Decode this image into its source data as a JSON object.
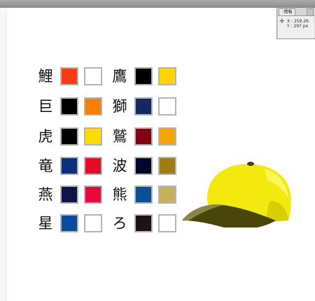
{
  "info_panel": {
    "tab_label": "情報",
    "x_label": "X",
    "x_value": ": 259.26",
    "y_label": "Y",
    "y_value": ": 297 px",
    "crosshair_icon": "crosshair-icon"
  },
  "teams": [
    {
      "name": "鯉",
      "colors": [
        "#fa3c14",
        "#ffffff"
      ]
    },
    {
      "name": "巨",
      "colors": [
        "#000000",
        "#f67f00"
      ]
    },
    {
      "name": "虎",
      "colors": [
        "#000000",
        "#ffdc00"
      ]
    },
    {
      "name": "竜",
      "colors": [
        "#0a2f7b",
        "#e60a28"
      ]
    },
    {
      "name": "燕",
      "colors": [
        "#0f1446",
        "#e6093c"
      ]
    },
    {
      "name": "星",
      "colors": [
        "#0a4b9e",
        "#ffffff"
      ]
    },
    {
      "name": "鷹",
      "colors": [
        "#000000",
        "#ffd400"
      ]
    },
    {
      "name": "獅",
      "colors": [
        "#132966",
        "#ffffff"
      ]
    },
    {
      "name": "鷲",
      "colors": [
        "#820014",
        "#f7a300"
      ]
    },
    {
      "name": "波",
      "colors": [
        "#000a28",
        "#a07d0f"
      ]
    },
    {
      "name": "熊",
      "colors": [
        "#0a5096",
        "#c8af5a"
      ]
    },
    {
      "name": "ろ",
      "colors": [
        "#1c1414",
        "#ffffff"
      ]
    }
  ],
  "cap": {
    "crown_color": "#f2ea0f",
    "highlight_color": "#fff45a",
    "shade_color": "#d9cf00",
    "bill_color": "#4a4508",
    "bill_edge_color": "#8a8646",
    "button_color": "#3c3c2a"
  }
}
